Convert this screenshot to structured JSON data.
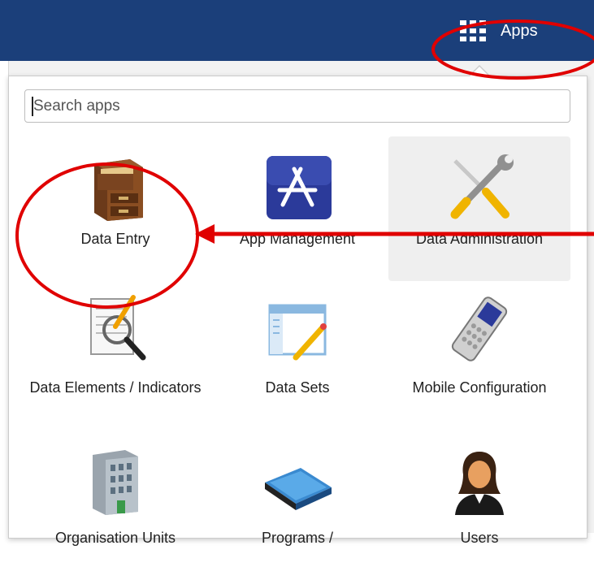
{
  "header": {
    "apps_label": "Apps",
    "bar_color": "#1b3f7a",
    "apps_icon": "grid-icon"
  },
  "search": {
    "placeholder": "Search apps",
    "value": ""
  },
  "apps": [
    {
      "label": "Data Entry",
      "icon": "filing-cabinet-icon"
    },
    {
      "label": "App Management",
      "icon": "app-store-icon"
    },
    {
      "label": "Data Administration",
      "icon": "wrench-screwdriver-icon"
    },
    {
      "label": "Data Elements / Indicators",
      "icon": "magnifier-document-icon"
    },
    {
      "label": "Data Sets",
      "icon": "window-pencil-icon"
    },
    {
      "label": "Mobile Configuration",
      "icon": "mobile-phone-icon"
    },
    {
      "label": "Organisation Units",
      "icon": "office-building-icon"
    },
    {
      "label": "Programs /",
      "icon": "book-icon"
    },
    {
      "label": "Users",
      "icon": "user-icon"
    }
  ],
  "annotation": {
    "color": "#e00000"
  }
}
